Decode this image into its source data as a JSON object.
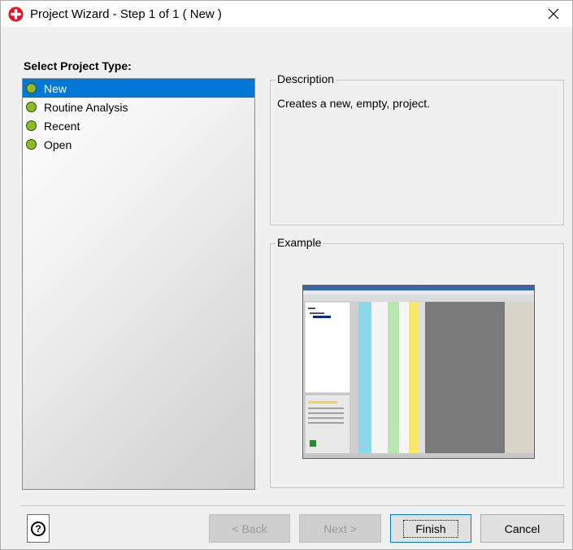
{
  "window": {
    "title": "Project Wizard - Step 1 of 1 ( New )",
    "close_glyph": "✕"
  },
  "select_heading": "Select Project Type:",
  "project_types": [
    {
      "label": "New",
      "selected": true
    },
    {
      "label": "Routine Analysis",
      "selected": false
    },
    {
      "label": "Recent",
      "selected": false
    },
    {
      "label": "Open",
      "selected": false
    }
  ],
  "description": {
    "legend": "Description",
    "text": "Creates a new, empty, project."
  },
  "example": {
    "legend": "Example"
  },
  "buttons": {
    "help": "?",
    "back": "< Back",
    "next": "Next >",
    "finish": "Finish",
    "cancel": "Cancel"
  },
  "colors": {
    "selection": "#0078d7",
    "status_dot": "#8dbb2a",
    "app_icon": "#e81123"
  }
}
